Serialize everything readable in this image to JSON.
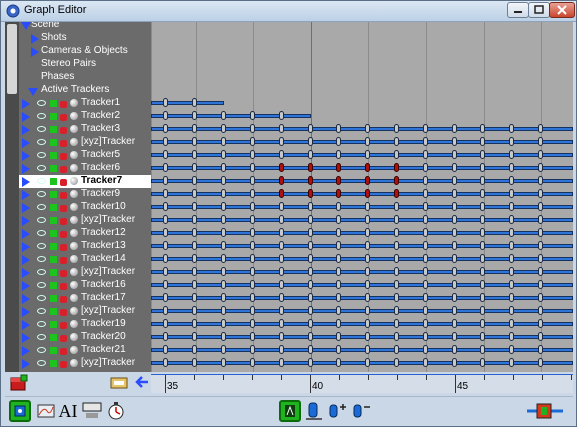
{
  "window": {
    "title": "Graph Editor"
  },
  "tree": {
    "scene_label": "Scene",
    "items": [
      {
        "label": "Shots",
        "expander": "right"
      },
      {
        "label": "Cameras & Objects",
        "expander": "right"
      },
      {
        "label": "Stereo Pairs",
        "expander": "none"
      },
      {
        "label": "Phases",
        "expander": "none"
      },
      {
        "label": "Active Trackers",
        "expander": "down"
      }
    ],
    "trackers": [
      "Tracker1",
      "Tracker2",
      "Tracker3",
      "[xyz]Tracker",
      "Tracker5",
      "Tracker6",
      "Tracker7",
      "Tracker9",
      "Tracker10",
      "[xyz]Tracker",
      "Tracker12",
      "Tracker13",
      "Tracker14",
      "[xyz]Tracker",
      "Tracker16",
      "Tracker17",
      "[xyz]Tracker",
      "Tracker19",
      "Tracker20",
      "Tracker21",
      "[xyz]Tracker"
    ],
    "selected_tracker_index": 6
  },
  "timeline": {
    "tick_labels": [
      "35",
      "40",
      "45"
    ]
  },
  "colors": {
    "accent": "#2a4cff",
    "bar": "#2f74d8",
    "key_red": "#b01010",
    "on_green": "#1ec41e",
    "lock_red": "#d9202a"
  },
  "toolbar": {
    "icons": [
      "tracker-view-icon",
      "graph-curve-icon",
      "ai-text-icon",
      "frame-only-icon",
      "stopwatch-icon",
      "green-tracker-icon",
      "zoom-to-fit-icon",
      "add-key-icon",
      "remove-key-icon",
      "settings-slider-icon"
    ]
  }
}
